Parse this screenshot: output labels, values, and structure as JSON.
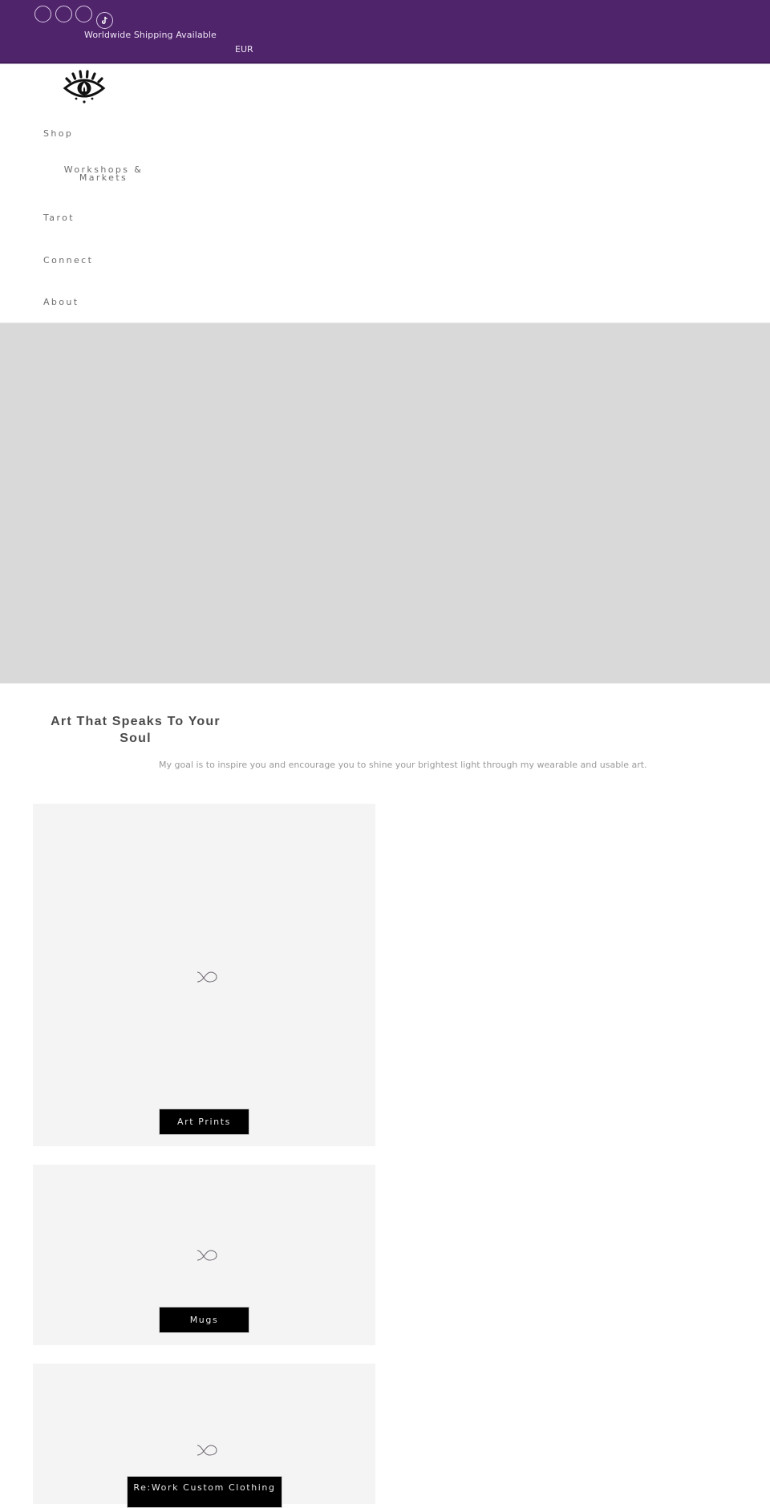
{
  "announcement": {
    "social_icons": [
      "social-icon",
      "social-icon",
      "social-icon",
      "tiktok-icon"
    ],
    "shipping_text": "Worldwide Shipping Available",
    "currency": "EUR",
    "background_color": "#4f246b"
  },
  "header": {
    "logo_icon": "eye-logo-icon",
    "nav": [
      {
        "label": "Shop"
      },
      {
        "label": "Workshops & Markets"
      },
      {
        "label": "Tarot"
      },
      {
        "label": "Connect"
      },
      {
        "label": "About"
      }
    ]
  },
  "hero": {
    "background_color": "#d9d9d9"
  },
  "intro": {
    "title": "Art That Speaks To Your Soul",
    "text": "My goal is to inspire you and encourage you to shine your brightest light through my wearable and usable art."
  },
  "collections": [
    {
      "label": "Art Prints",
      "icon": "image-placeholder-icon"
    },
    {
      "label": "Mugs",
      "icon": "image-placeholder-icon"
    },
    {
      "label": "Re:Work Custom Clothing",
      "icon": "image-placeholder-icon"
    }
  ]
}
